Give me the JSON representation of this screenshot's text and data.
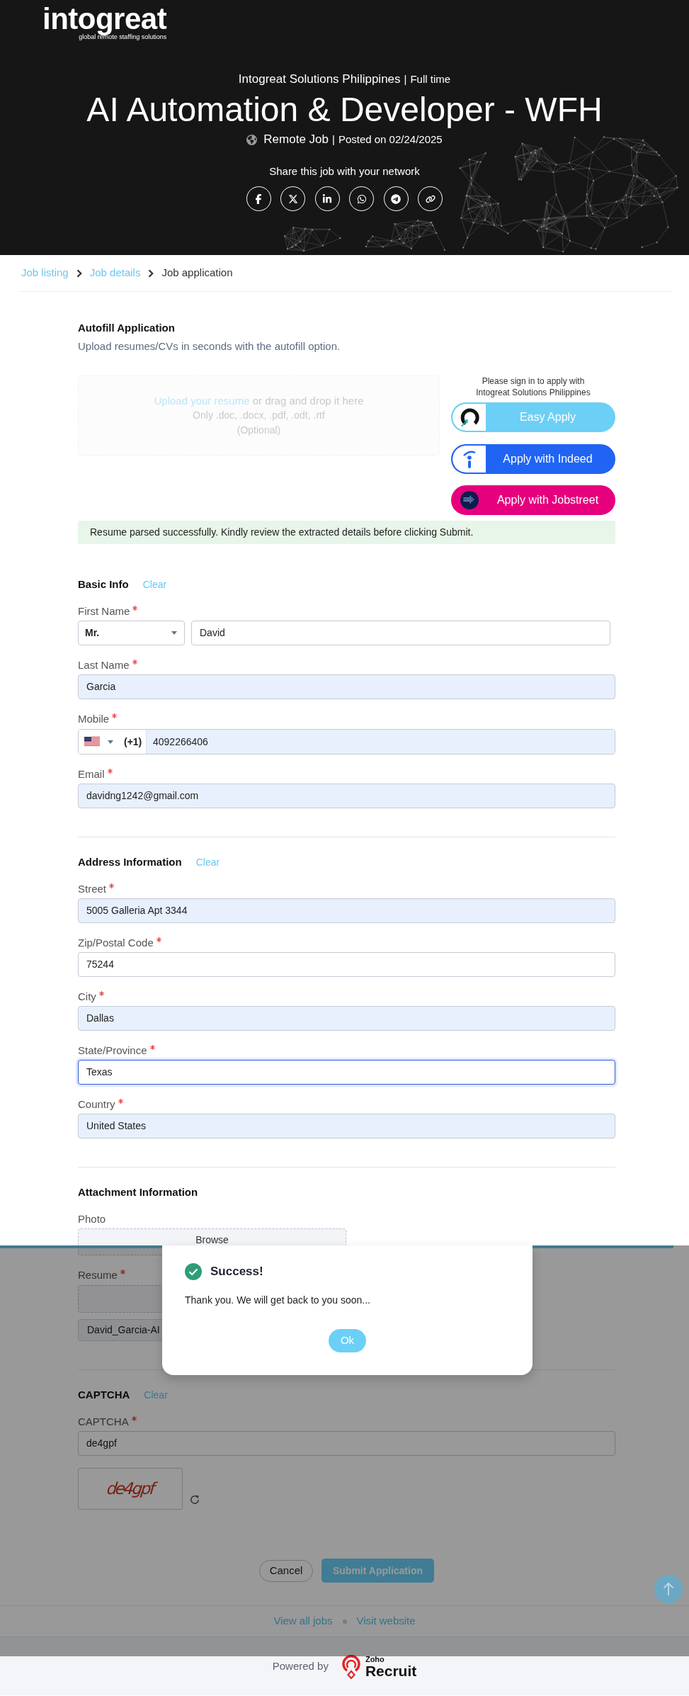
{
  "header": {
    "logo": {
      "wordmark": "intogreat",
      "tagline": "global remote staffing solutions"
    },
    "company_line": {
      "company": "Intogreat Solutions Philippines",
      "separator": "|",
      "type": "Full time"
    },
    "title": "AI Automation & Developer - WFH",
    "meta_line": {
      "location": "Remote Job",
      "separator": "|",
      "posted": "Posted on 02/24/2025"
    },
    "share_label": "Share this job with your network",
    "share_buttons": [
      {
        "kind": "facebook"
      },
      {
        "kind": "x"
      },
      {
        "kind": "linkedin"
      },
      {
        "kind": "whatsapp"
      },
      {
        "kind": "telegram"
      },
      {
        "kind": "link"
      }
    ]
  },
  "breadcrumbs": [
    {
      "label": "Job listing",
      "link": true
    },
    {
      "label": "Job details",
      "link": true
    },
    {
      "label": "Job application",
      "link": false
    }
  ],
  "autofill": {
    "title": "Autofill Application",
    "subtitle": "Upload resumes/CVs in seconds with the autofill option.",
    "dropzone": {
      "link": "Upload your resume",
      "text": "or drag and drop it here",
      "formats": "Only .doc, .docx, .pdf, .odt, .rtf",
      "note": "(Optional)",
      "disabled": true
    },
    "sign_in_note": [
      "Please sign in to apply with",
      "Intogreat Solutions Philippines"
    ],
    "apply_buttons": [
      {
        "kind": "easy",
        "label": "Easy Apply"
      },
      {
        "kind": "indeed",
        "label": "Apply with Indeed"
      },
      {
        "kind": "jobstreet",
        "label": "Apply with Jobstreet"
      }
    ],
    "status": "Resume parsed successfully. Kindly review the extracted details before clicking Submit."
  },
  "sections": [
    {
      "title": "Basic Info",
      "clear": "Clear",
      "fields": [
        {
          "kind": "name",
          "label": "First Name",
          "required": true,
          "salutation": "Mr.",
          "value": "David",
          "autofilled": false,
          "focused": false
        },
        {
          "kind": "text",
          "label": "Last Name",
          "required": true,
          "value": "Garcia",
          "autofilled": true,
          "focused": false
        },
        {
          "kind": "phone",
          "label": "Mobile",
          "required": true,
          "code": "(+1)",
          "value": "4092266406",
          "autofilled": true,
          "focused": false
        },
        {
          "kind": "text",
          "label": "Email",
          "required": true,
          "value": "davidng1242@gmail.com",
          "autofilled": true,
          "focused": false
        }
      ]
    },
    {
      "title": "Address Information",
      "clear": "Clear",
      "fields": [
        {
          "kind": "text",
          "label": "Street",
          "required": true,
          "value": "5005 Galleria Apt 3344",
          "autofilled": true,
          "focused": false
        },
        {
          "kind": "text",
          "label": "Zip/Postal Code",
          "required": true,
          "value": "75244",
          "autofilled": false,
          "focused": false
        },
        {
          "kind": "text",
          "label": "City",
          "required": true,
          "value": "Dallas",
          "autofilled": true,
          "focused": false
        },
        {
          "kind": "text",
          "label": "State/Province",
          "required": true,
          "value": "Texas",
          "autofilled": false,
          "focused": true
        },
        {
          "kind": "text",
          "label": "Country",
          "required": true,
          "value": "United States",
          "autofilled": true,
          "focused": false
        }
      ]
    },
    {
      "title": "Attachment Information",
      "fields": [
        {
          "kind": "file",
          "label": "Photo",
          "required": false,
          "button": "Browse"
        },
        {
          "kind": "file",
          "label": "Resume",
          "required": true,
          "file": "David_Garcia-AI"
        }
      ]
    },
    {
      "title": "CAPTCHA",
      "clear": "Clear",
      "fields": [
        {
          "kind": "text",
          "label": "CAPTCHA",
          "required": true,
          "value": "de4gpf",
          "autofilled": false,
          "focused": false
        },
        {
          "kind": "captcha",
          "image_text": "de4gpf"
        }
      ]
    }
  ],
  "actions": {
    "cancel": "Cancel",
    "submit": "Submit Application"
  },
  "footer": {
    "links": [
      "View all jobs",
      "Visit website"
    ],
    "powered_by": "Powered by",
    "brand_small": "Zoho",
    "brand": "Recruit"
  },
  "modal": {
    "title": "Success!",
    "message": "Thank you. We will get back to you soon...",
    "button": "Ok"
  }
}
